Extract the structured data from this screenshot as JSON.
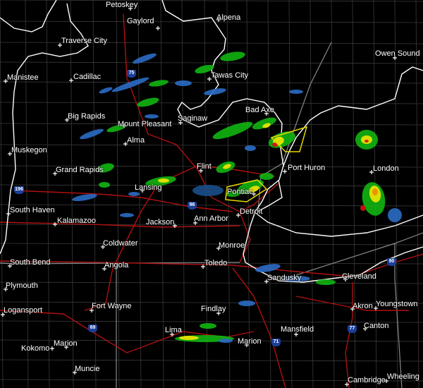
{
  "map": {
    "colors": {
      "background": "#000000",
      "county_lines": "#3a3a3a",
      "state_lines": "#8a8a8a",
      "interstates": "#b01010",
      "shoreline": "#ffffff",
      "warning_polygon": "#e8d800",
      "radar_light": "#2b6cc4",
      "radar_green": "#11b511",
      "radar_yellow": "#f2e600",
      "radar_orange": "#f08a00",
      "radar_red": "#d01010"
    },
    "cities": [
      "Petoskey",
      "Gaylord",
      "Alpena",
      "Traverse City",
      "Owen Sound",
      "Manistee",
      "Cadillac",
      "Tawas City",
      "Bad Axe",
      "Big Rapids",
      "Mount Pleasant",
      "Saginaw",
      "Alma",
      "Muskegon",
      "Flint",
      "Port Huron",
      "London",
      "Grand Rapids",
      "Lansing",
      "Pontiac",
      "South Haven",
      "Detroit",
      "Kalamazoo",
      "Jackson",
      "Ann Arbor",
      "Coldwater",
      "Monroe",
      "South Bend",
      "Angola",
      "Toledo",
      "Cleveland",
      "Sandusky",
      "Plymouth",
      "Fort Wayne",
      "Findlay",
      "Akron",
      "Youngstown",
      "Logansport",
      "Canton",
      "Mansfield",
      "Marion",
      "Lima",
      "Kokomo",
      "Marion",
      "Muncie",
      "Cambridge",
      "Wheeling"
    ],
    "highway_shields": [
      "75",
      "196",
      "96",
      "90",
      "69",
      "71",
      "77"
    ]
  }
}
